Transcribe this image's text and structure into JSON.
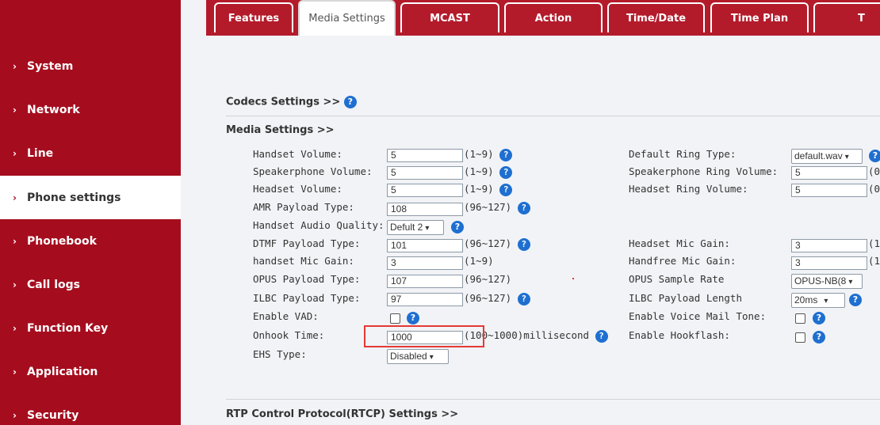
{
  "sidebar": {
    "items": [
      {
        "label": "System"
      },
      {
        "label": "Network"
      },
      {
        "label": "Line"
      },
      {
        "label": "Phone settings"
      },
      {
        "label": "Phonebook"
      },
      {
        "label": "Call logs"
      },
      {
        "label": "Function Key"
      },
      {
        "label": "Application"
      },
      {
        "label": "Security"
      }
    ],
    "active": "Phone settings"
  },
  "tabs": [
    {
      "label": "Features"
    },
    {
      "label": "Media Settings"
    },
    {
      "label": "MCAST"
    },
    {
      "label": "Action"
    },
    {
      "label": "Time/Date"
    },
    {
      "label": "Time Plan"
    },
    {
      "label": "T"
    }
  ],
  "sections": {
    "codecs": "Codecs Settings >>",
    "media": "Media Settings >>",
    "rtcp": "RTP Control Protocol(RTCP) Settings >>"
  },
  "left_fields": {
    "handset_volume": {
      "label": "Handset Volume:",
      "value": "5",
      "range": "(1~9)"
    },
    "speakerphone_volume": {
      "label": "Speakerphone Volume:",
      "value": "5",
      "range": "(1~9)"
    },
    "headset_volume": {
      "label": "Headset Volume:",
      "value": "5",
      "range": "(1~9)"
    },
    "amr_payload": {
      "label": "AMR Payload Type:",
      "value": "108",
      "range": "(96~127)"
    },
    "handset_audio_quality": {
      "label": "Handset Audio Quality:",
      "value": "Defult 2"
    },
    "dtmf_payload": {
      "label": "DTMF Payload Type:",
      "value": "101",
      "range": "(96~127)"
    },
    "handset_mic_gain": {
      "label": "handset Mic Gain:",
      "value": "3",
      "range": "(1~9)"
    },
    "opus_payload": {
      "label": "OPUS Payload Type:",
      "value": "107",
      "range": "(96~127)"
    },
    "ilbc_payload": {
      "label": "ILBC Payload Type:",
      "value": "97",
      "range": "(96~127)"
    },
    "enable_vad": {
      "label": "Enable VAD:"
    },
    "onhook_time": {
      "label": "Onhook Time:",
      "value": "1000",
      "range": "(100~1000)millisecond"
    },
    "ehs_type": {
      "label": "EHS Type:",
      "value": "Disabled"
    }
  },
  "right_fields": {
    "default_ring_type": {
      "label": "Default Ring Type:",
      "value": "default.wav"
    },
    "speakerphone_ring_volume": {
      "label": "Speakerphone Ring Volume:",
      "value": "5",
      "range": "(0"
    },
    "headset_ring_volume": {
      "label": "Headset Ring Volume:",
      "value": "5",
      "range": "(0"
    },
    "headset_mic_gain": {
      "label": "Headset Mic Gain:",
      "value": "3",
      "range": "(1"
    },
    "handfree_mic_gain": {
      "label": "Handfree Mic Gain:",
      "value": "3",
      "range": "(1"
    },
    "opus_sample_rate": {
      "label": "OPUS Sample Rate",
      "value": "OPUS-NB(8"
    },
    "ilbc_payload_length": {
      "label": "ILBC Payload Length",
      "value": "20ms"
    },
    "enable_voice_mail_tone": {
      "label": "Enable Voice Mail Tone:"
    },
    "enable_hookflash": {
      "label": "Enable Hookflash:"
    }
  },
  "colors": {
    "sidebar": "#a50d1e",
    "tabbar": "#b31b2b",
    "help_icon": "#1e6fd0",
    "highlight": "#e53935"
  },
  "icons": {
    "help": "help-circle-icon",
    "chevron": "chevron-right-icon"
  }
}
